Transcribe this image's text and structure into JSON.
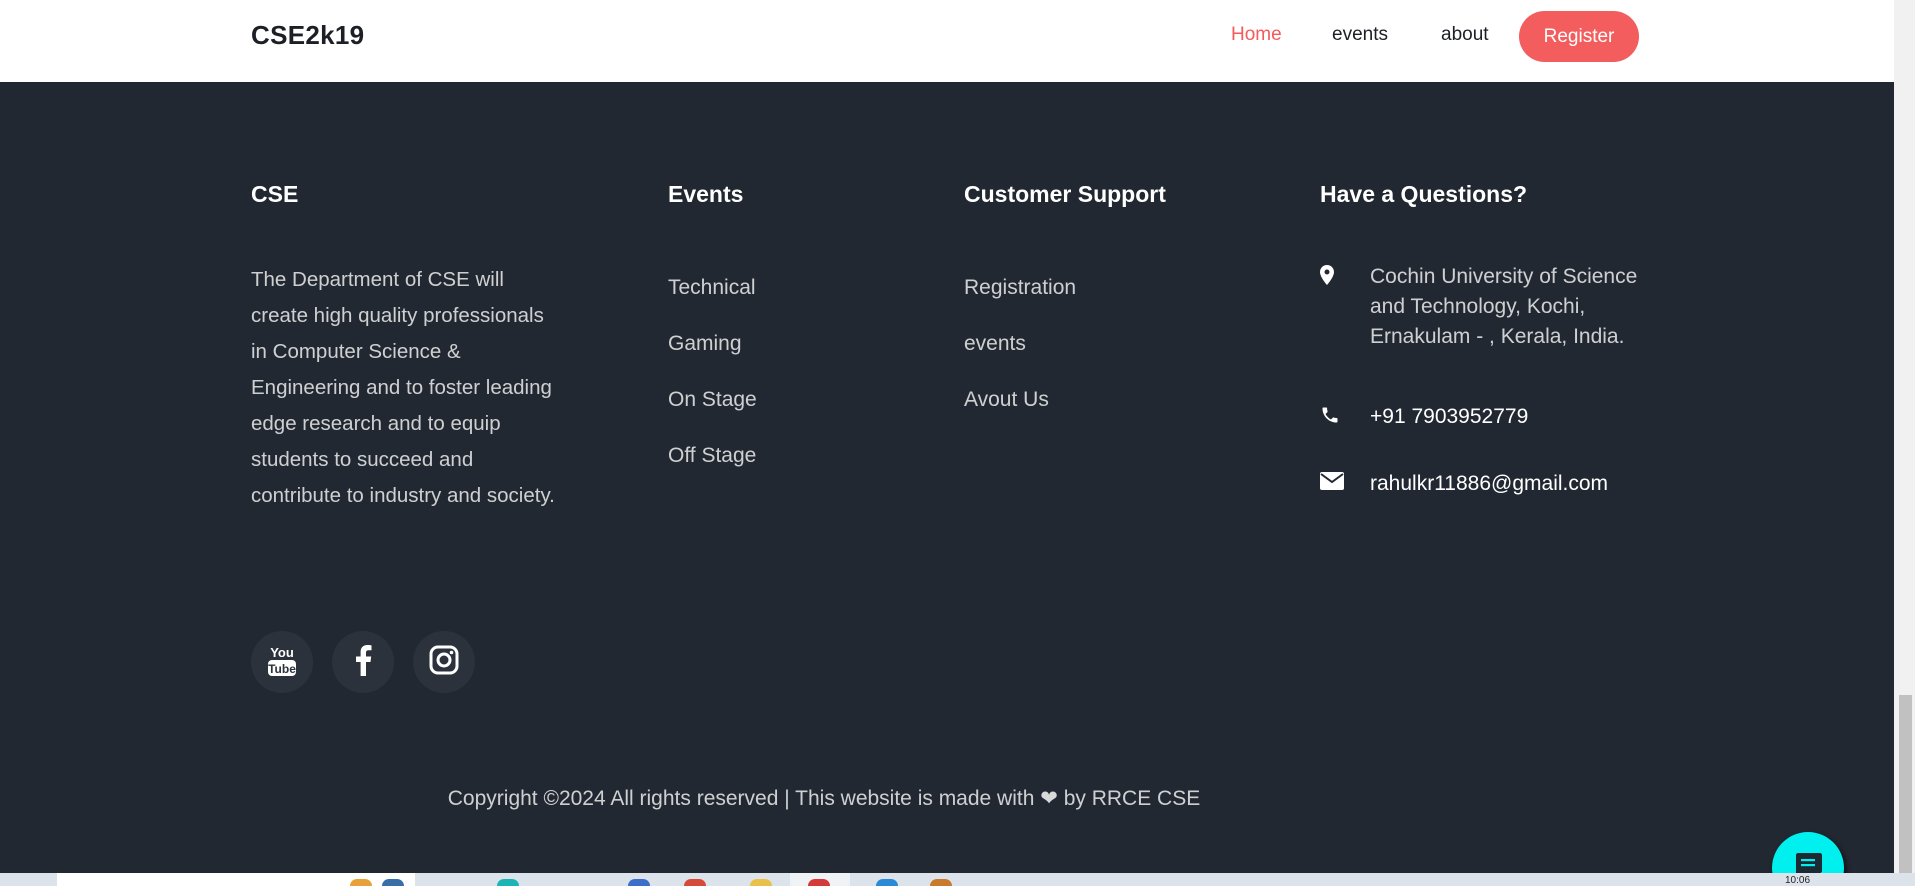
{
  "navbar": {
    "brand": "CSE2k19",
    "links": [
      "Home",
      "events",
      "about"
    ],
    "register_label": "Register"
  },
  "footer": {
    "about": {
      "title": "CSE",
      "text": "The Department of CSE will create high quality professionals in Computer Science & Engineering and to foster leading edge research and to equip students to succeed and contribute to industry and society."
    },
    "events": {
      "title": "Events",
      "items": [
        "Technical",
        "Gaming",
        "On Stage",
        "Off Stage"
      ]
    },
    "support": {
      "title": "Customer Support",
      "items": [
        "Registration",
        "events",
        "Avout Us"
      ]
    },
    "contact": {
      "title": "Have a Questions?",
      "address": "Cochin University of Science and Technology, Kochi, Ernakulam - , Kerala, India.",
      "phone": "+91 7903952779",
      "email": "rahulkr11886@gmail.com"
    },
    "social": [
      {
        "icon": "youtube-icon"
      },
      {
        "icon": "facebook-icon"
      },
      {
        "icon": "instagram-icon"
      }
    ],
    "copyright_before": "Copyright ©2024 All rights reserved | This website is made with",
    "copyright_after": "by RRCE CSE"
  },
  "taskbar": {
    "clock": "10:06"
  },
  "colors": {
    "accent": "#f45d5d",
    "footer_bg": "#222831",
    "chat_button": "#00f0f0"
  }
}
